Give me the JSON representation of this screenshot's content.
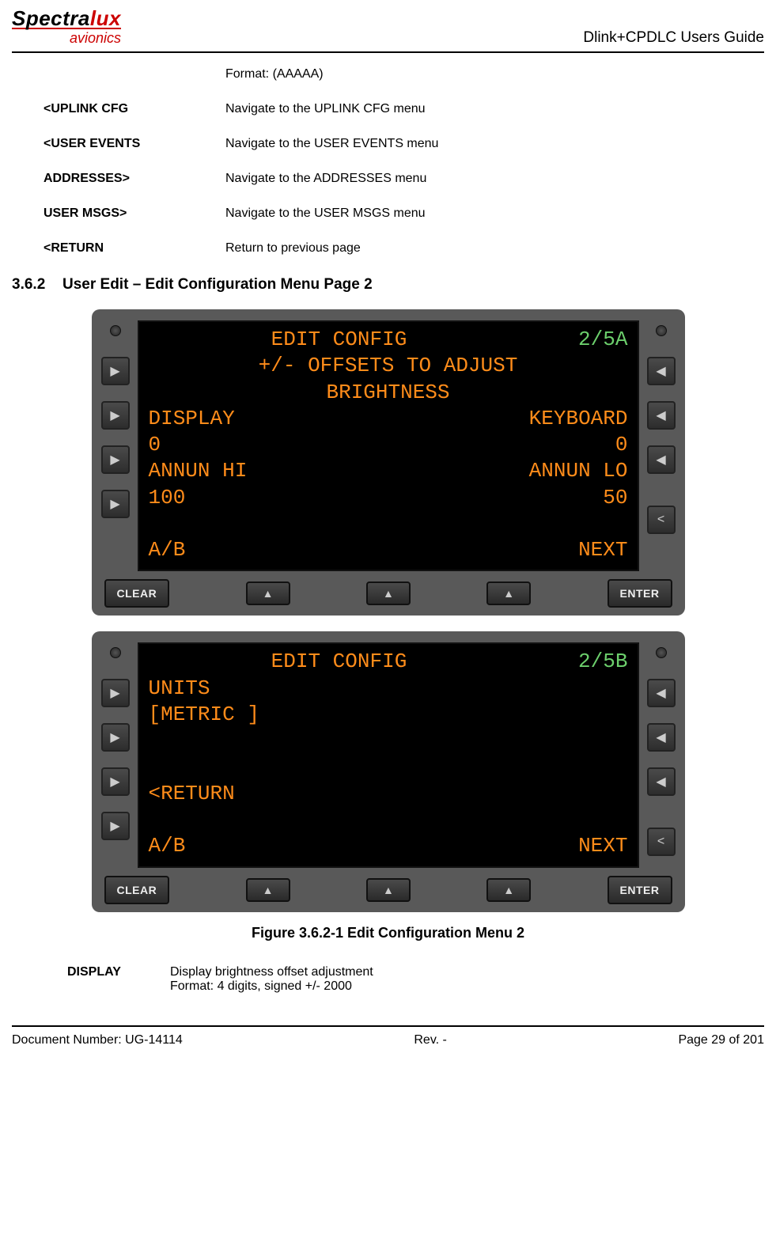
{
  "header": {
    "logo_main_a": "Spectra",
    "logo_main_b": "lux",
    "logo_sub": "avionics",
    "doc_title": "Dlink+CPDLC Users Guide"
  },
  "format_line": "Format: (AAAAA)",
  "defs": [
    {
      "term": "<UPLINK CFG",
      "desc": "Navigate to the UPLINK CFG menu"
    },
    {
      "term": "<USER EVENTS",
      "desc": "Navigate to the USER EVENTS menu"
    },
    {
      "term": "ADDRESSES>",
      "desc": "Navigate to the ADDRESSES menu"
    },
    {
      "term": "USER MSGS>",
      "desc": "Navigate to the USER MSGS menu"
    },
    {
      "term": "<RETURN",
      "desc": "Return to previous page"
    }
  ],
  "section": {
    "num": "3.6.2",
    "title": "User Edit – Edit Configuration Menu Page 2"
  },
  "screenA": {
    "title": "EDIT CONFIG",
    "page": "2/5A",
    "sub1": "+/- OFFSETS TO ADJUST",
    "sub2": "BRIGHTNESS",
    "l1_left": "DISPLAY",
    "l1_right": "KEYBOARD",
    "l2_left": "0",
    "l2_right": "0",
    "l3_left": "ANNUN HI",
    "l3_right": "ANNUN LO",
    "l4_left": "100",
    "l4_right": "50",
    "l5_left": "A/B",
    "l5_right": "NEXT"
  },
  "screenB": {
    "title": "EDIT CONFIG",
    "page": "2/5B",
    "l1_left": "UNITS",
    "l2_left": "[METRIC ]",
    "l3_left": "<RETURN",
    "l4_left": "A/B",
    "l4_right": "NEXT"
  },
  "buttons": {
    "clear": "CLEAR",
    "enter": "ENTER"
  },
  "figure_caption": "Figure 3.6.2-1 Edit Configuration Menu 2",
  "lower_def": {
    "term": "DISPLAY",
    "line1": "Display brightness offset adjustment",
    "line2": "Format: 4 digits, signed +/- 2000"
  },
  "footer": {
    "left": "Document Number:  UG-14114",
    "center": "Rev. -",
    "right": "Page 29 of 201"
  }
}
